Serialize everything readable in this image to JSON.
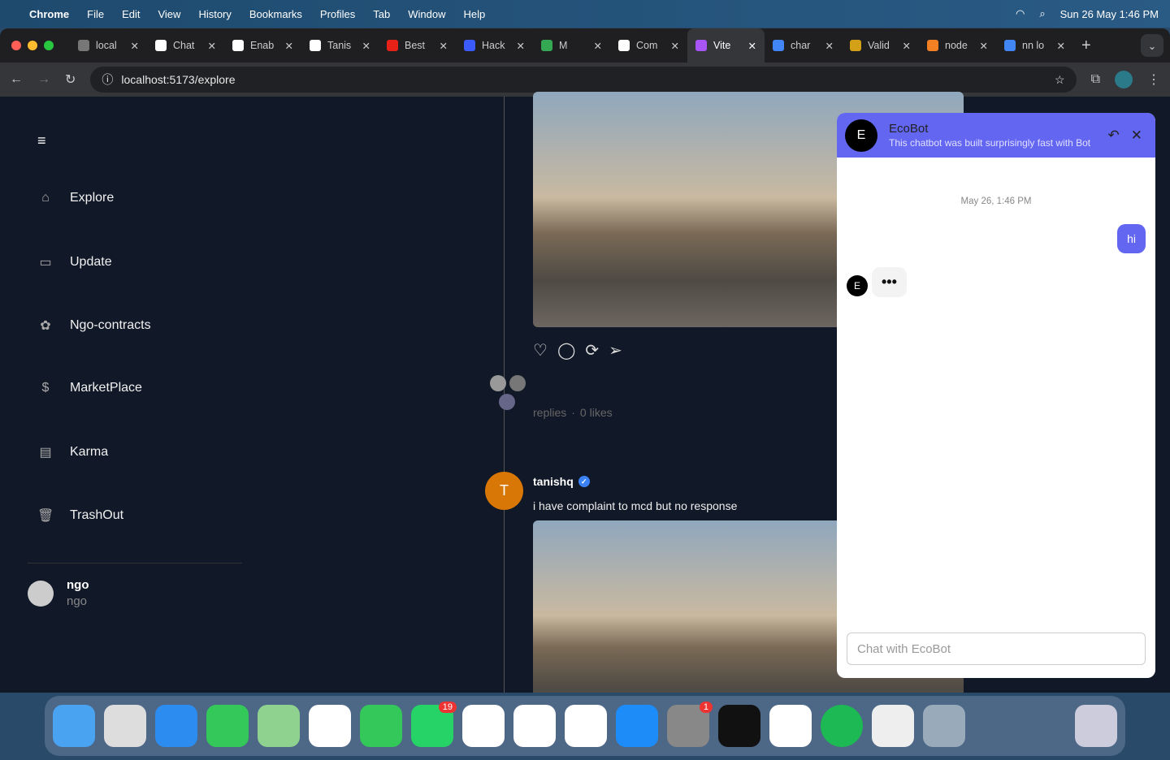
{
  "menubar": {
    "app": "Chrome",
    "items": [
      "File",
      "Edit",
      "View",
      "History",
      "Bookmarks",
      "Profiles",
      "Tab",
      "Window",
      "Help"
    ],
    "clock": "Sun 26 May  1:46 PM"
  },
  "tabs": [
    {
      "title": "local",
      "color": "#777"
    },
    {
      "title": "Chat",
      "color": "#fff"
    },
    {
      "title": "Enab",
      "color": "#fff"
    },
    {
      "title": "Tanis",
      "color": "#fff"
    },
    {
      "title": "Best",
      "color": "#e62117"
    },
    {
      "title": "Hack",
      "color": "#3b5bfd"
    },
    {
      "title": "M",
      "color": "#34a853"
    },
    {
      "title": "Com",
      "color": "#fff"
    },
    {
      "title": "Vite",
      "color": "#a855f7",
      "active": true
    },
    {
      "title": "char",
      "color": "#4285f4"
    },
    {
      "title": "Valid",
      "color": "#d4a017"
    },
    {
      "title": "node",
      "color": "#f48024"
    },
    {
      "title": "nn lo",
      "color": "#4285f4"
    }
  ],
  "address": {
    "url": "localhost:5173/explore"
  },
  "sidebar": {
    "items": [
      {
        "label": "Explore",
        "icon": "home-icon"
      },
      {
        "label": "Update",
        "icon": "calendar-icon"
      },
      {
        "label": "Ngo-contracts",
        "icon": "paw-icon"
      },
      {
        "label": "MarketPlace",
        "icon": "dollar-icon"
      },
      {
        "label": "Karma",
        "icon": "briefcase-icon"
      },
      {
        "label": "TrashOut",
        "icon": "trash-icon"
      }
    ],
    "user": {
      "name": "ngo",
      "handle": "ngo"
    }
  },
  "feed": {
    "post1": {
      "replies": "replies",
      "likes": "0 likes",
      "sep": "·"
    },
    "post2": {
      "avatar": "T",
      "author": "tanishq",
      "text": "i have complaint to mcd but no response"
    }
  },
  "chat": {
    "avatar": "E",
    "title": "EcoBot",
    "subtitle": "This chatbot was built surprisingly fast with Bot",
    "timestamp": "May 26, 1:46 PM",
    "user_msg": "hi",
    "typing": "•••",
    "placeholder": "Chat with EcoBot",
    "accent": "#6366f1"
  },
  "dock": {
    "whatsapp_badge": "19",
    "settings_badge": "1"
  }
}
